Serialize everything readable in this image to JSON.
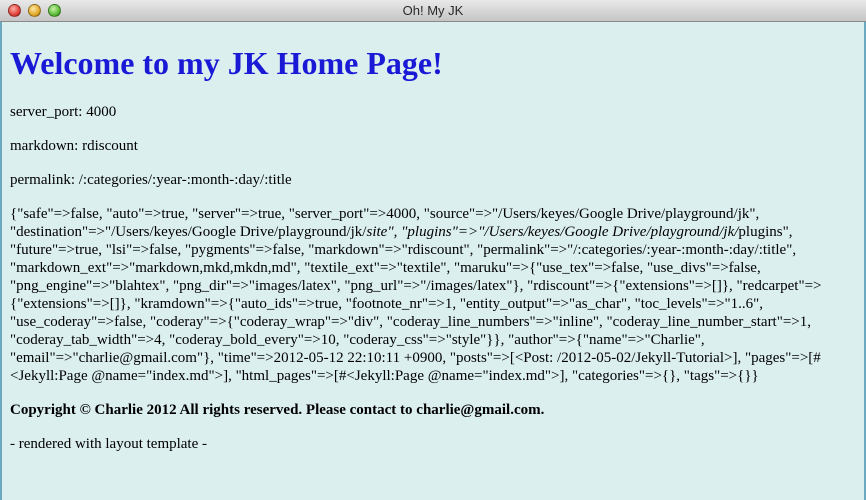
{
  "window": {
    "title": "Oh! My JK"
  },
  "page": {
    "heading": "Welcome to my JK Home Page!",
    "server_port": "server_port: 4000",
    "markdown": "markdown: rdiscount",
    "permalink": "permalink: /:categories/:year-:month-:day/:title",
    "site_dump": {
      "part1": "{\"safe\"=>false, \"auto\"=>true, \"server\"=>true, \"server_port\"=>4000, \"source\"=>\"/Users/keyes/Google Drive/playground/jk\", \"destination\"=>\"/Users/keyes/Google Drive/playground/jk/",
      "em1": "site\", \"plugins\"=>\"/Users/keyes/Google Drive/playground/jk/",
      "part2": "plugins\", \"future\"=>true, \"lsi\"=>false, \"pygments\"=>false, \"markdown\"=>\"rdiscount\", \"permalink\"=>\"/:categories/:year-:month-:day/:title\", \"markdown_ext\"=>\"markdown,mkd,mkdn,md\", \"textile_ext\"=>\"textile\", \"maruku\"=>{\"use_tex\"=>false, \"use_divs\"=>false, \"png_engine\"=>\"blahtex\", \"png_dir\"=>\"images/latex\", \"png_url\"=>\"/images/latex\"}, \"rdiscount\"=>{\"extensions\"=>[]}, \"redcarpet\"=>{\"extensions\"=>[]}, \"kramdown\"=>{\"auto_ids\"=>true, \"footnote_nr\"=>1, \"entity_output\"=>\"as_char\", \"toc_levels\"=>\"1..6\", \"use_coderay\"=>false, \"coderay\"=>{\"coderay_wrap\"=>\"div\", \"coderay_line_numbers\"=>\"inline\", \"coderay_line_number_start\"=>1, \"coderay_tab_width\"=>4, \"coderay_bold_every\"=>10, \"coderay_css\"=>\"style\"}}, \"author\"=>{\"name\"=>\"Charlie\", \"email\"=>\"charlie@gmail.com\"}, \"time\"=>2012-05-12 22:10:11 +0900, \"posts\"=>[<Post: /2012-05-02/Jekyll-Tutorial>], \"pages\"=>[#<Jekyll:Page @name=\"index.md\">], \"html_pages\"=>[#<Jekyll:Page @name=\"index.md\">], \"categories\"=>{}, \"tags\"=>{}}"
    },
    "copyright": "Copyright © Charlie 2012 All rights reserved. Please contact to charlie@gmail.com.",
    "footer": "- rendered with layout template -"
  }
}
